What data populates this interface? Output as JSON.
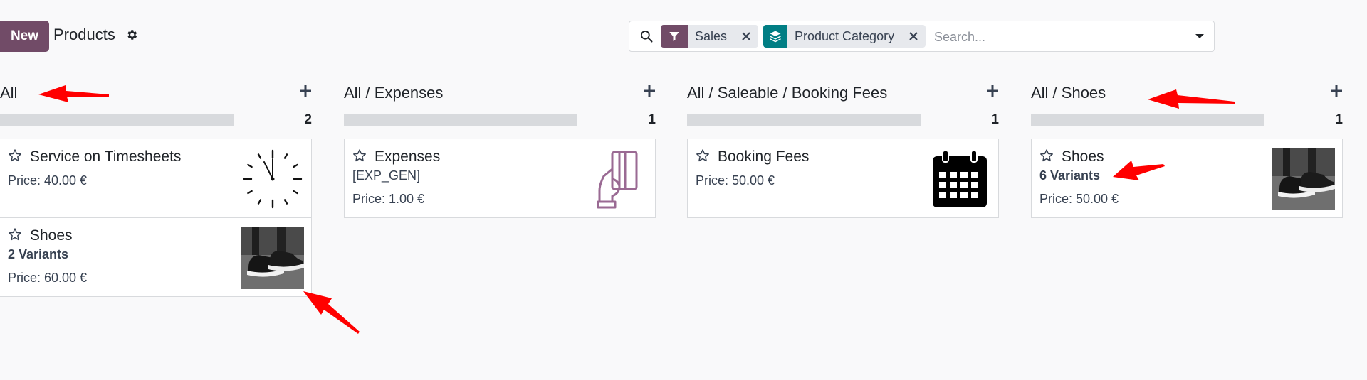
{
  "control_panel": {
    "new_label": "New",
    "title": "Products",
    "search": {
      "facets": [
        {
          "label": "Sales",
          "icon": "filter-icon",
          "color": "#714b67"
        },
        {
          "label": "Product Category",
          "icon": "layers-icon",
          "color": "#017e84"
        }
      ],
      "placeholder": "Search..."
    }
  },
  "columns": [
    {
      "title": "All",
      "count": "2",
      "cards": [
        {
          "name": "Service on Timesheets",
          "sub": "",
          "price": "Price: 40.00 €",
          "image": "clock-icon"
        },
        {
          "name": "Shoes",
          "sub": "2 Variants",
          "price": "Price: 60.00 €",
          "image": "shoes-photo"
        }
      ]
    },
    {
      "title": "All / Expenses",
      "count": "1",
      "cards": [
        {
          "name": "Expenses",
          "sub": "[EXP_GEN]",
          "price": "Price: 1.00 €",
          "image": "credit-card-hand-icon"
        }
      ]
    },
    {
      "title": "All / Saleable / Booking Fees",
      "count": "1",
      "cards": [
        {
          "name": "Booking Fees",
          "sub": "",
          "price": "Price: 50.00 €",
          "image": "calendar-icon"
        }
      ]
    },
    {
      "title": "All / Shoes",
      "count": "1",
      "cards": [
        {
          "name": "Shoes",
          "sub": "6 Variants",
          "price": "Price: 50.00 €",
          "image": "shoes-photo"
        }
      ]
    }
  ],
  "colors": {
    "brand": "#714b67",
    "teal": "#017e84",
    "annotation": "#ff0000"
  }
}
